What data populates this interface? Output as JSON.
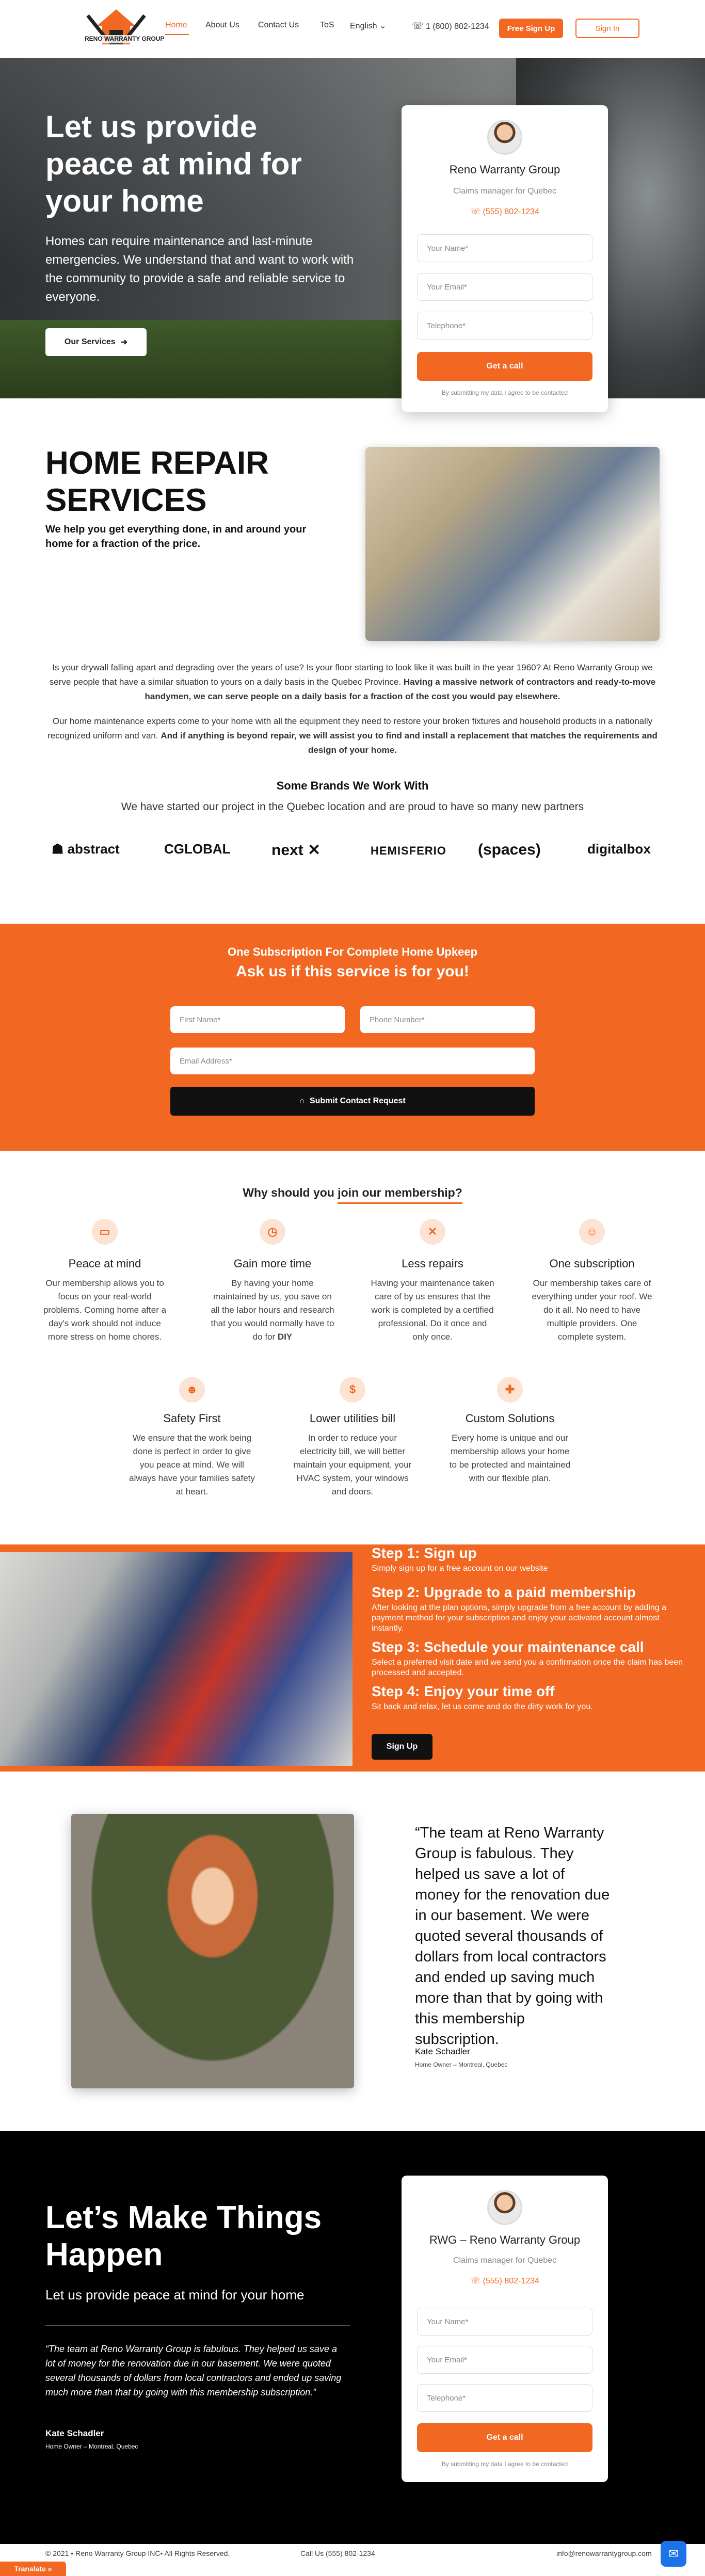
{
  "header": {
    "logo_text": "RENO WARRANTY GROUP",
    "nav": [
      "Home",
      "About Us",
      "Contact Us",
      "ToS",
      "English"
    ],
    "phone": "1 (800) 802-1234",
    "signup": "Free Sign Up",
    "signin": "Sign In"
  },
  "hero": {
    "title": "Let us provide peace at mind for your home",
    "text": "Homes can require maintenance and last-minute emergencies. We understand that and want to work with the community to provide a safe and reliable service to everyone.",
    "button": "Our Services"
  },
  "contact_card": {
    "name": "Reno Warranty Group",
    "role": "Claims manager for Quebec",
    "phone": "(555) 802-1234",
    "name_placeholder": "Your Name*",
    "email_placeholder": "Your Email*",
    "phone_placeholder": "Telephone*",
    "button": "Get a call",
    "fine": "By submitting my data I agree to be contacted"
  },
  "services": {
    "title": "HOME REPAIR SERVICES",
    "subtitle": "We help you get everything done, in and around your home for a fraction of the price.",
    "p1_a": "Is your drywall falling apart and degrading over the years of use? Is your floor starting to look like it was built in the year 1960? At Reno Warranty Group we serve people that have a similar situation to yours on a daily basis in the Quebec Province. ",
    "p1_b": "Having a massive network of contractors and ready-to-move handymen, we can serve people on a daily basis for a fraction of the cost you would pay elsewhere.",
    "p2_a": "Our home maintenance experts come to your home with all the equipment they need to restore your broken fixtures and household products in a nationally recognized uniform and van. ",
    "p2_b": "And if anything is beyond repair, we will assist you to find and install a replacement that matches the requirements and design of your home.",
    "brands_title": "Some Brands We Work With",
    "brands_sub": "We have started our project in the Quebec location and are proud to have so many new partners",
    "brands": [
      "abstract",
      "CGLOBAL",
      "next",
      "HEMISFERIO",
      "(spaces)",
      "digitalbox"
    ]
  },
  "subscribe": {
    "kicker": "One Subscription For Complete Home Upkeep",
    "title": "Ask us if this service is for you!",
    "first_name": "First Name*",
    "phone_number": "Phone Number*",
    "email": "Email Address*",
    "button": "Submit Contact Request"
  },
  "features": {
    "title_a": "Why should you ",
    "title_b": "join our membership?",
    "items": [
      {
        "title": "Peace at mind",
        "text": "Our membership allows you to focus on your real-world problems. Coming home after a day's work should not induce more stress on home chores."
      },
      {
        "title": "Gain more time",
        "text": "By having your home maintained by us, you save on all the labor hours and research that you would normally have to do for ",
        "bold": "DIY"
      },
      {
        "title": "Less repairs",
        "text": "Having your maintenance taken care of by us ensures that the work is completed by a certified professional. Do it once and only once."
      },
      {
        "title": "One subscription",
        "text": "Our membership takes care of everything under your roof. We do it all. No need to have multiple providers. One complete system."
      },
      {
        "title": "Safety First",
        "text": "We ensure that the work being done is perfect in order to give you peace at mind. We will always have your families safety at heart."
      },
      {
        "title": "Lower utilities bill",
        "text": "In order to reduce your electricity bill, we will better maintain your equipment, your HVAC system, your windows and doors."
      },
      {
        "title": "Custom Solutions",
        "text": "Every home is unique and our membership allows your home to be protected and maintained with our flexible plan."
      }
    ]
  },
  "steps": {
    "items": [
      {
        "title": "Step 1: Sign up",
        "text": "Simply sign up for a free account on our website"
      },
      {
        "title": "Step 2: Upgrade to a paid membership",
        "text": "After looking at the plan options, simply upgrade from a free account by adding a payment method for your subscription and enjoy your activated account almost instantly."
      },
      {
        "title": "Step 3: Schedule your maintenance call",
        "text": "Select a preferred visit date and we send you a confirmation once the claim has been processed and accepted."
      },
      {
        "title": "Step 4: Enjoy your time off",
        "text": "Sit back and relax, let us come and do the dirty work for you."
      }
    ],
    "button": "Sign Up"
  },
  "testimonial": {
    "quote": "“The team at Reno Warranty Group is fabulous. They helped us save a lot of money for the renovation due in our basement. We were quoted several thousands of dollars from local contractors and ended up saving much more than that by going with this membership subscription.",
    "author": "Kate Schadler",
    "location": "Home Owner – Montreal, Quebec"
  },
  "cta": {
    "title": "Let’s Make Things Happen",
    "subtitle": "Let us provide peace at mind for your home",
    "quote": "“The team at Reno Warranty Group is fabulous. They helped us save a lot of money for the renovation due in our basement. We were quoted several thousands of dollars from local contractors and ended up saving much more than that by going with this membership subscription.”",
    "author": "Kate Schadler",
    "location": "Home Owner – Montreal, Quebec",
    "card_name": "RWG – Reno Warranty Group",
    "card_role": "Claims manager for Quebec",
    "card_phone": "(555) 802-1234"
  },
  "footer": {
    "copyright": "© 2021 • Reno Warranty Group INC• All Rights Reserved.",
    "call": "Call Us (555) 802-1234",
    "email": "info@renowarrantygroup.com",
    "translate": "Translate »"
  },
  "colors": {
    "accent": "#f26722",
    "dark": "#000000"
  }
}
